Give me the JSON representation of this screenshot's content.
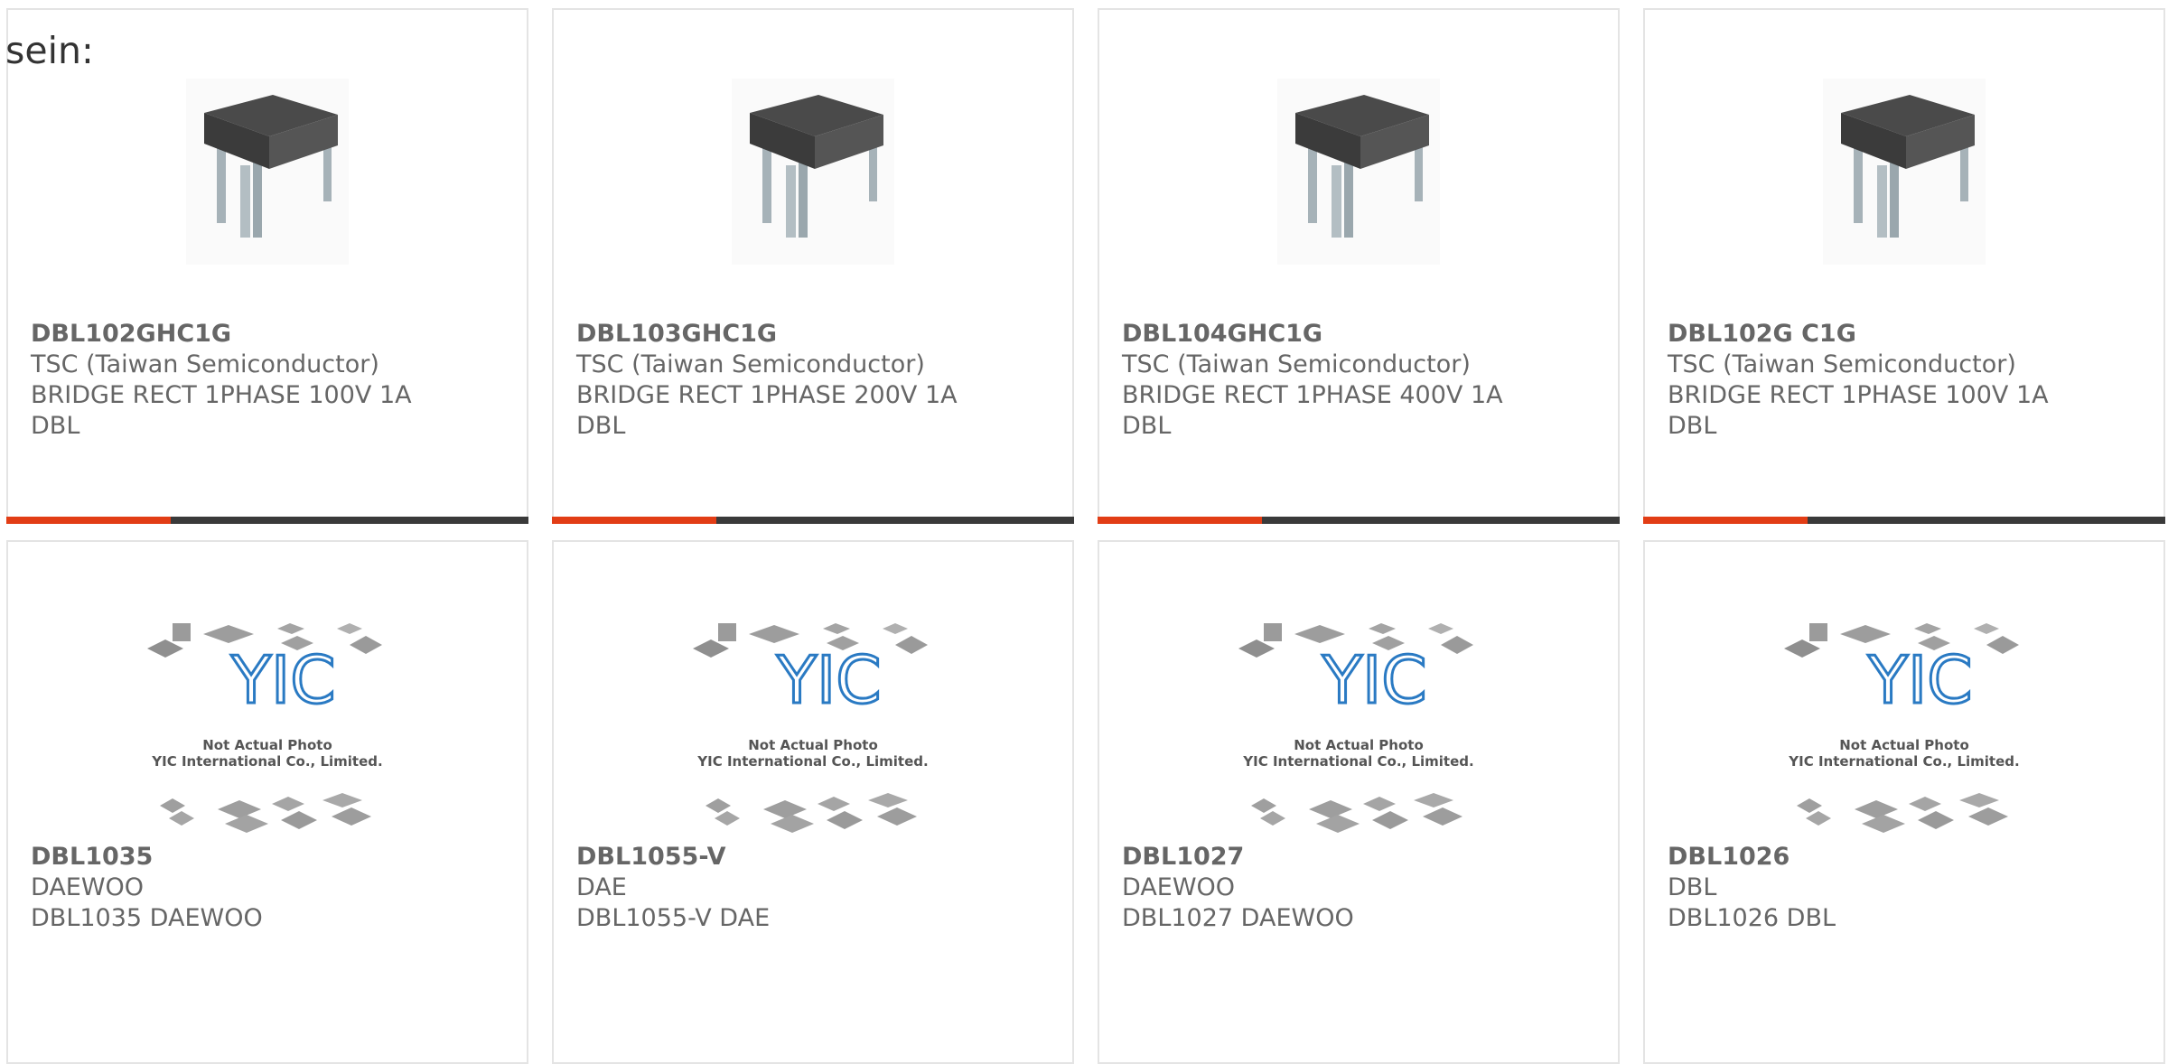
{
  "intro_text": "sein:",
  "colors": {
    "accent": "#e23d15",
    "bar": "#3a3a3a",
    "logo_blue": "#2a7ac3",
    "text": "#666666"
  },
  "products": [
    {
      "part": "DBL102GHC1G",
      "maker": "TSC (Taiwan Semiconductor)",
      "desc": "BRIDGE RECT 1PHASE 100V 1A",
      "pkg": "DBL",
      "image": "bridge-rectifier-photo"
    },
    {
      "part": "DBL103GHC1G",
      "maker": "TSC (Taiwan Semiconductor)",
      "desc": "BRIDGE RECT 1PHASE 200V 1A",
      "pkg": "DBL",
      "image": "bridge-rectifier-photo"
    },
    {
      "part": "DBL104GHC1G",
      "maker": "TSC (Taiwan Semiconductor)",
      "desc": "BRIDGE RECT 1PHASE 400V 1A",
      "pkg": "DBL",
      "image": "bridge-rectifier-photo"
    },
    {
      "part": "DBL102G C1G",
      "maker": "TSC (Taiwan Semiconductor)",
      "desc": "BRIDGE RECT 1PHASE 100V 1A",
      "pkg": "DBL",
      "image": "bridge-rectifier-photo"
    },
    {
      "part": "DBL1035",
      "maker": "DAEWOO",
      "desc": "DBL1035 DAEWOO",
      "image": "not-actual-photo-placeholder"
    },
    {
      "part": "DBL1055-V",
      "maker": "DAE",
      "desc": "DBL1055-V DAE",
      "image": "not-actual-photo-placeholder"
    },
    {
      "part": "DBL1027",
      "maker": "DAEWOO",
      "desc": "DBL1027 DAEWOO",
      "image": "not-actual-photo-placeholder"
    },
    {
      "part": "DBL1026",
      "maker": "DBL",
      "desc": "DBL1026 DBL",
      "image": "not-actual-photo-placeholder"
    }
  ],
  "placeholder": {
    "logo_text": "YIC",
    "line1": "Not Actual Photo",
    "line2": "YIC International Co., Limited."
  }
}
